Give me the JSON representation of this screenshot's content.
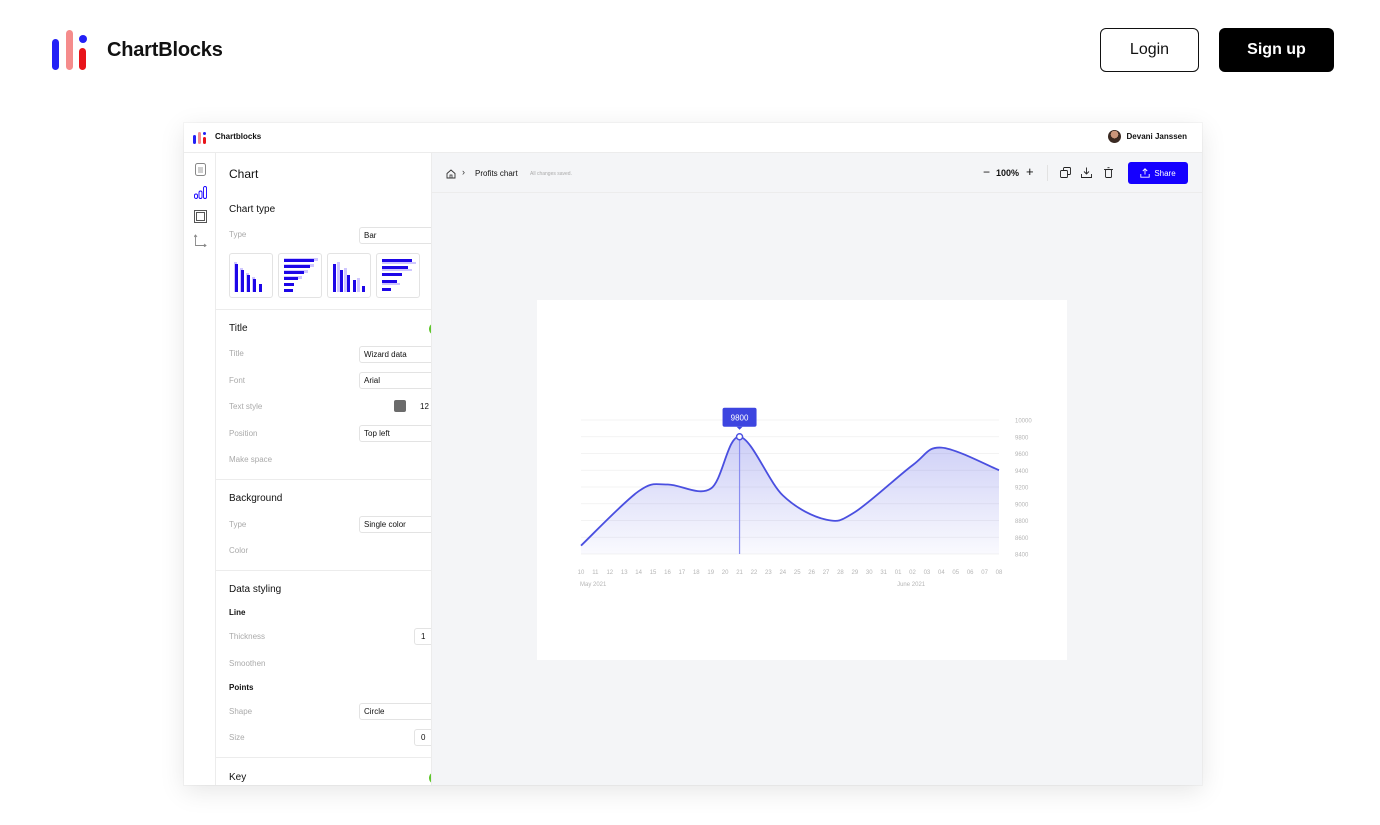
{
  "site": {
    "brand_name": "ChartBlocks",
    "login_label": "Login",
    "signup_label": "Sign up",
    "brand_colors": [
      "#2320f6",
      "#f58c8c",
      "#e8141a"
    ]
  },
  "app": {
    "name": "Chartblocks",
    "user_name": "Devani Janssen",
    "accent": "#1500ff",
    "rail_icons": [
      "document-icon",
      "bar-chart-icon",
      "frame-icon",
      "axes-icon"
    ]
  },
  "panel": {
    "title": "Chart",
    "chart_type": {
      "heading": "Chart type",
      "type_label": "Type",
      "type_value": "Bar",
      "thumbnails": [
        "vertical-bar-thumbnail",
        "horizontal-bar-thumbnail",
        "grouped-vertical-bar-thumbnail",
        "grouped-horizontal-bar-thumbnail"
      ]
    },
    "title_section": {
      "heading": "Title",
      "enabled": true,
      "title_label": "Title",
      "title_value": "Wizard data",
      "font_label": "Font",
      "font_value": "Arial",
      "text_style_label": "Text style",
      "text_size": "12",
      "position_label": "Position",
      "position_value": "Top left",
      "make_space_label": "Make space",
      "make_space_checked": false
    },
    "background": {
      "heading": "Background",
      "type_label": "Type",
      "type_value": "Single color",
      "color_label": "Color",
      "color_value": "#6b6b6b"
    },
    "data_styling": {
      "heading": "Data styling",
      "line_heading": "Line",
      "thickness_label": "Thickness",
      "thickness_value": "1",
      "smoothen_label": "Smoothen",
      "smoothen_checked": true,
      "points_heading": "Points",
      "shape_label": "Shape",
      "shape_value": "Circle",
      "size_label": "Size",
      "size_value": "0"
    },
    "key": {
      "heading": "Key",
      "enabled": true
    }
  },
  "workspace": {
    "breadcrumb_name": "Profits chart",
    "saved_status": "All changes saved.",
    "zoom": "100%",
    "share_label": "Share"
  },
  "chart_data": {
    "type": "area",
    "series": [
      {
        "name": "",
        "color": "#4a4fe0",
        "points": [
          [
            "10 May 2021",
            8500
          ],
          [
            "14 May 2021",
            9150
          ],
          [
            "16 May 2021",
            9230
          ],
          [
            "19 May 2021",
            9180
          ],
          [
            "21 May 2021",
            9800
          ],
          [
            "24 May 2021",
            9100
          ],
          [
            "27 May 2021",
            8810
          ],
          [
            "29 May 2021",
            8900
          ],
          [
            "02 Jun 2021",
            9460
          ],
          [
            "04 Jun 2021",
            9670
          ],
          [
            "08 Jun 2021",
            9400
          ]
        ]
      }
    ],
    "x_ticks": [
      "10",
      "11",
      "12",
      "13",
      "14",
      "15",
      "16",
      "17",
      "18",
      "19",
      "20",
      "21",
      "22",
      "23",
      "24",
      "25",
      "26",
      "27",
      "28",
      "29",
      "30",
      "31",
      "01",
      "02",
      "03",
      "04",
      "05",
      "06",
      "07",
      "08"
    ],
    "x_month_labels": [
      {
        "label": "May 2021",
        "tick": "10"
      },
      {
        "label": "June 2021",
        "tick": "01"
      }
    ],
    "y_ticks": [
      10000,
      9800,
      9600,
      9400,
      9200,
      9000,
      8800,
      8600,
      8400
    ],
    "ylim": [
      8400,
      10000
    ],
    "y_axis_position": "right",
    "grid": true,
    "highlight": {
      "tick": "21",
      "value": 9800,
      "label": "9800"
    }
  }
}
